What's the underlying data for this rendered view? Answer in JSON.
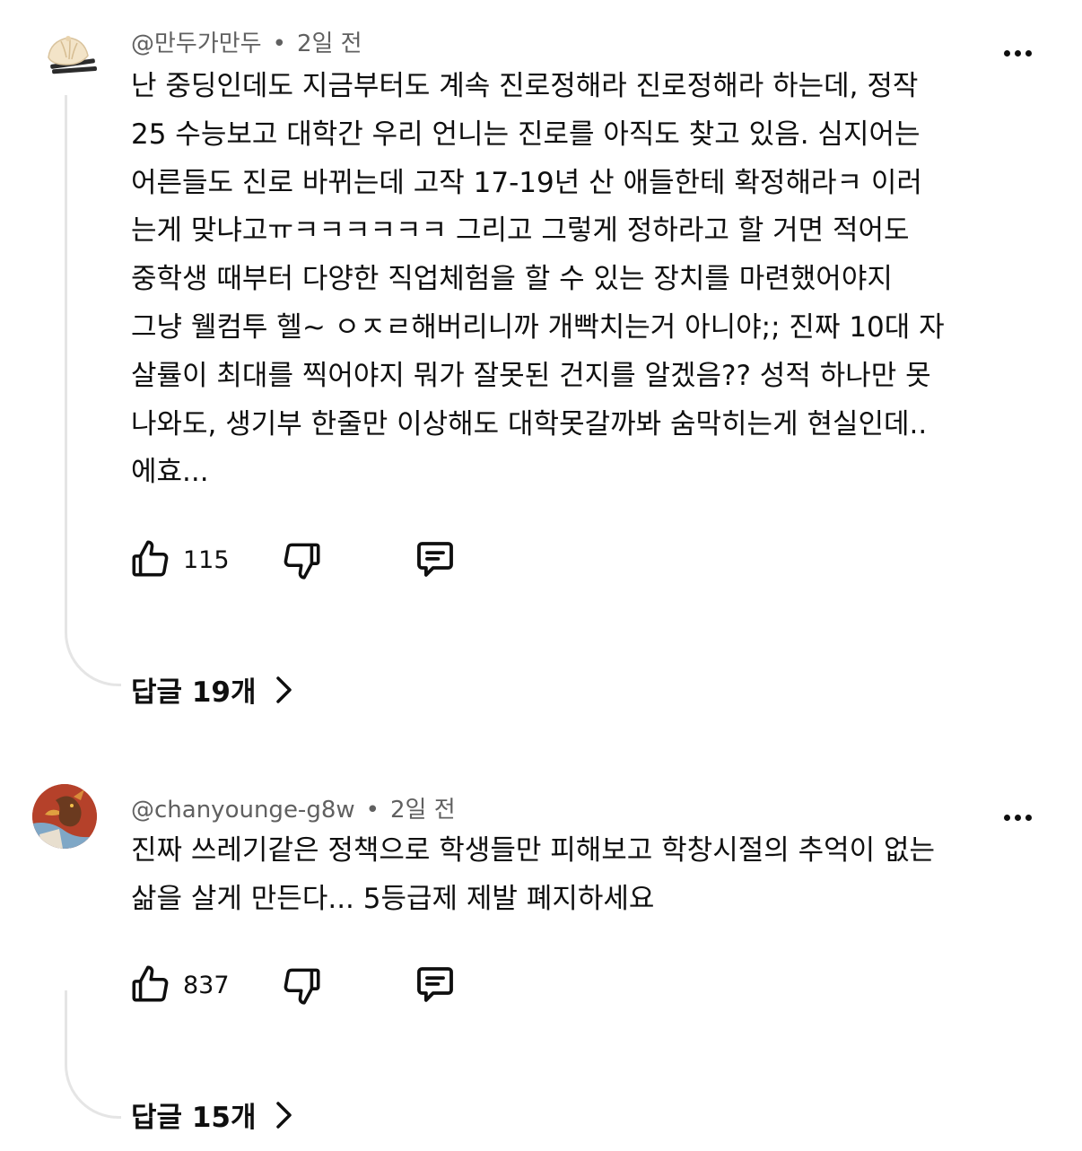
{
  "comments": [
    {
      "author": "@만두가만두",
      "time": "2일 전",
      "lines": [
        "난 중딩인데도 지금부터도 계속 진로정해라 진로정해라 하는데, 정작",
        "25 수능보고 대학간 우리 언니는 진로를 아직도 찾고 있음. 심지어는",
        "어른들도 진로 바뀌는데 고작 17-19년 산 애들한테 확정해라ㅋ 이러",
        "는게 맞냐고ㅠㅋㅋㅋㅋㅋㅋ 그리고 그렇게 정하라고 할 거면 적어도",
        "중학생 때부터 다양한 직업체험을 할 수 있는 장치를 마련했어야지",
        "그냥 웰컴투 헬~ ㅇㅈㄹ해버리니까 개빡치는거 아니야;; 진짜 10대 자",
        "살률이 최대를 찍어야지 뭐가 잘못된 건지를 알겠음?? 성적 하나만 못",
        "나와도, 생기부 한줄만 이상해도 대학못갈까봐 숨막히는게 현실인데..",
        "에효..."
      ],
      "likes": "115",
      "replies": "답글 19개",
      "avatar_icon": "dumpling-avatar-icon"
    },
    {
      "author": "@chanyounge-g8w",
      "time": "2일 전",
      "lines": [
        "진짜 쓰레기같은 정책으로 학생들만 피해보고 학창시절의 추억이 없는",
        "삶을 살게 만든다... 5등급제 제발 폐지하세요"
      ],
      "likes": "837",
      "replies": "답글 15개",
      "avatar_icon": "dragon-avatar-icon"
    }
  ]
}
